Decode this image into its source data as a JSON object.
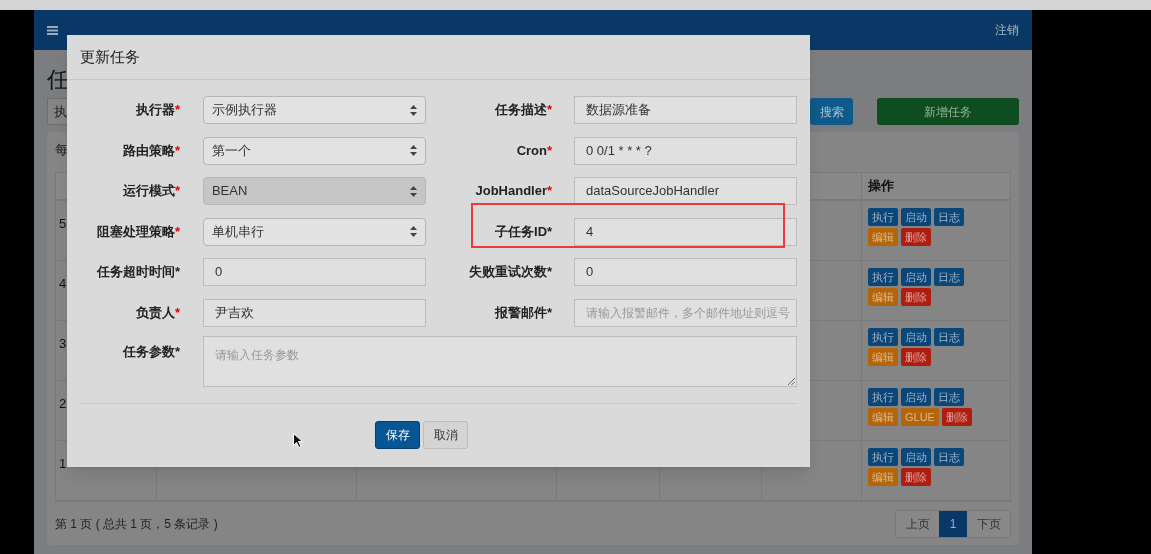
{
  "navbar": {
    "logout": "注销"
  },
  "page": {
    "title": "任",
    "filter_select": "执",
    "search_button": "搜索",
    "add_button": "新增任务",
    "per_page": "每"
  },
  "table": {
    "columns": [
      "操作"
    ],
    "rows": [
      {
        "id": "5",
        "actions": [
          {
            "label": "执行",
            "kind": "primary"
          },
          {
            "label": "启动",
            "kind": "primary"
          },
          {
            "label": "日志",
            "kind": "primary"
          },
          {
            "label": "编辑",
            "kind": "warning"
          },
          {
            "label": "删除",
            "kind": "danger"
          }
        ]
      },
      {
        "id": "4",
        "actions": [
          {
            "label": "执行",
            "kind": "primary"
          },
          {
            "label": "启动",
            "kind": "primary"
          },
          {
            "label": "日志",
            "kind": "primary"
          },
          {
            "label": "编辑",
            "kind": "warning"
          },
          {
            "label": "删除",
            "kind": "danger"
          }
        ]
      },
      {
        "id": "3",
        "actions": [
          {
            "label": "执行",
            "kind": "primary"
          },
          {
            "label": "启动",
            "kind": "primary"
          },
          {
            "label": "日志",
            "kind": "primary"
          },
          {
            "label": "编辑",
            "kind": "warning"
          },
          {
            "label": "删除",
            "kind": "danger"
          }
        ]
      },
      {
        "id": "2",
        "actions": [
          {
            "label": "执行",
            "kind": "primary"
          },
          {
            "label": "启动",
            "kind": "primary"
          },
          {
            "label": "日志",
            "kind": "primary"
          },
          {
            "label": "编辑",
            "kind": "warning"
          },
          {
            "label": "GLUE",
            "kind": "warning"
          },
          {
            "label": "删除",
            "kind": "danger"
          }
        ]
      },
      {
        "id": "1",
        "actions": [
          {
            "label": "执行",
            "kind": "primary"
          },
          {
            "label": "启动",
            "kind": "primary"
          },
          {
            "label": "日志",
            "kind": "primary"
          },
          {
            "label": "编辑",
            "kind": "warning"
          },
          {
            "label": "删除",
            "kind": "danger"
          }
        ]
      }
    ]
  },
  "footer": {
    "summary": "第 1 页 ( 总共 1 页，5 条记录 )",
    "pagination": [
      {
        "label": "上页",
        "selected": false
      },
      {
        "label": "1",
        "selected": true
      },
      {
        "label": "下页",
        "selected": false
      }
    ]
  },
  "modal": {
    "title": "更新任务",
    "rows": [
      {
        "left": {
          "label": "执行器",
          "mark": "*",
          "color": "#e00000",
          "kind": "select",
          "value": "示例执行器",
          "disabled": false
        },
        "right": {
          "label": "任务描述",
          "mark": "*",
          "color": "#e00000",
          "kind": "input",
          "value": "数据源准备",
          "highlighted": false
        }
      },
      {
        "left": {
          "label": "路由策略",
          "mark": "*",
          "color": "#e00000",
          "kind": "select",
          "value": "第一个",
          "disabled": false
        },
        "right": {
          "label": "Cron",
          "mark": "*",
          "color": "#e00000",
          "kind": "input",
          "value": "0 0/1 * * * ?",
          "highlighted": false
        }
      },
      {
        "left": {
          "label": "运行模式",
          "mark": "*",
          "color": "#e00000",
          "kind": "select",
          "value": "BEAN",
          "disabled": true
        },
        "right": {
          "label": "JobHandler",
          "mark": "*",
          "color": "#e00000",
          "kind": "input",
          "value": "dataSourceJobHandler",
          "highlighted": false
        }
      },
      {
        "left": {
          "label": "阻塞处理策略",
          "mark": "*",
          "color": "#e00000",
          "kind": "select",
          "value": "单机串行",
          "disabled": false
        },
        "right": {
          "label": "子任务ID",
          "mark": "*",
          "color": "#222222",
          "kind": "input",
          "value": "4",
          "highlighted": true
        }
      },
      {
        "left": {
          "label": "任务超时时间",
          "mark": "*",
          "color": "#222222",
          "kind": "input",
          "value": "0"
        },
        "right": {
          "label": "失败重试次数",
          "mark": "*",
          "color": "#222222",
          "kind": "input",
          "value": "0",
          "highlighted": false
        }
      },
      {
        "left": {
          "label": "负责人",
          "mark": "*",
          "color": "#e00000",
          "kind": "input",
          "value": "尹吉欢"
        },
        "right": {
          "label": "报警邮件",
          "mark": "*",
          "color": "#222222",
          "kind": "input",
          "placeholder": "请输入报警邮件，多个邮件地址则逗号",
          "highlighted": false
        }
      }
    ],
    "params": {
      "label": "任务参数",
      "mark": "*",
      "color": "#222222",
      "placeholder": "请输入任务参数"
    },
    "buttons": [
      {
        "label": "保存",
        "kind": "primary"
      },
      {
        "label": "取消",
        "kind": "default"
      }
    ]
  }
}
